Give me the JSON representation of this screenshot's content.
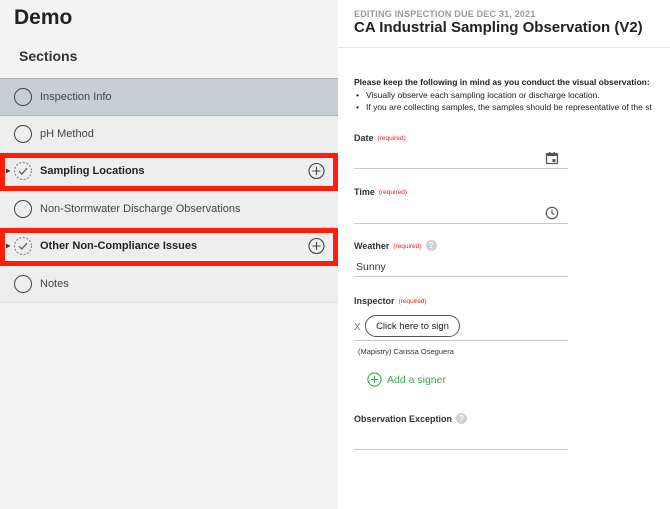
{
  "app": {
    "title": "Demo"
  },
  "sidebar": {
    "heading": "Sections",
    "items": [
      {
        "label": "Inspection Info",
        "state": "active",
        "status": "empty-circle"
      },
      {
        "label": "pH Method",
        "state": "normal",
        "status": "empty-circle"
      },
      {
        "label": "Sampling Locations",
        "state": "flagged",
        "status": "check-circle",
        "has_add": true
      },
      {
        "label": "Non-Stormwater Discharge Observations",
        "state": "normal",
        "status": "empty-circle"
      },
      {
        "label": "Other Non-Compliance Issues",
        "state": "flagged",
        "status": "check-circle",
        "has_add": true
      },
      {
        "label": "Notes",
        "state": "normal",
        "status": "empty-circle"
      }
    ]
  },
  "header": {
    "eyebrow": "EDITING INSPECTION DUE DEC 31, 2021",
    "title": "CA Industrial Sampling Observation (V2)"
  },
  "notice": {
    "lead": "Please keep the following in mind as you conduct the visual observation:",
    "bullets": [
      "Visually observe each sampling location or discharge location.",
      "If you are collecting samples, the samples should be representative of the st"
    ]
  },
  "form": {
    "required_tag": "(required)",
    "date": {
      "label": "Date",
      "value": ""
    },
    "time": {
      "label": "Time",
      "value": ""
    },
    "weather": {
      "label": "Weather",
      "value": "Sunny"
    },
    "inspector": {
      "label": "Inspector",
      "x_mark": "X",
      "sign_button": "Click here to sign",
      "signer": "(Mapistry) Carissa Oseguera",
      "add_signer": "Add a signer"
    },
    "observation_exception": {
      "label": "Observation Exception",
      "value": ""
    }
  },
  "colors": {
    "flag_outline": "#ff1e0a",
    "active_item_bg": "#c6d0d3",
    "required": "#e02020",
    "add_signer": "#3aa94a"
  }
}
